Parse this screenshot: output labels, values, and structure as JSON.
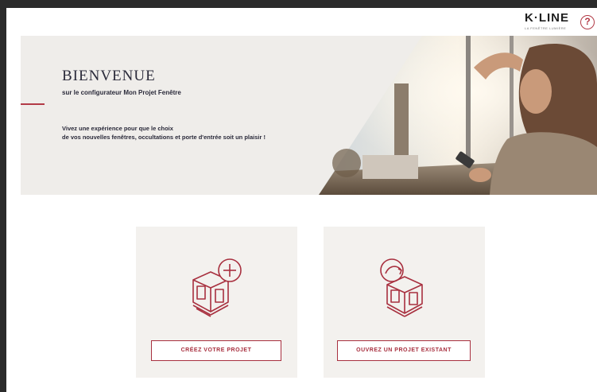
{
  "header": {
    "logo_text": "K·LINE",
    "logo_tagline": "LA FENÊTRE LUMIÈRE",
    "help_label": "?"
  },
  "hero": {
    "title": "BIENVENUE",
    "subtitle_prefix": "sur le configurateur ",
    "subtitle_product": "Mon Projet Fenêtre",
    "text_line1": "Vivez une expérience pour que le choix",
    "text_line2": "de vos nouvelles fenêtres, occultations et porte d'entrée soit un plaisir !"
  },
  "cards": {
    "create": {
      "button_label": "CRÉEZ VOTRE PROJET",
      "icon": "house-plus-icon"
    },
    "open": {
      "button_label": "OUVREZ UN PROJET EXISTANT",
      "icon": "house-open-icon"
    }
  },
  "colors": {
    "accent": "#b23a46",
    "hero_bg": "#efedea",
    "card_bg": "#f3f1ee",
    "text_dark": "#2a2a3a"
  }
}
